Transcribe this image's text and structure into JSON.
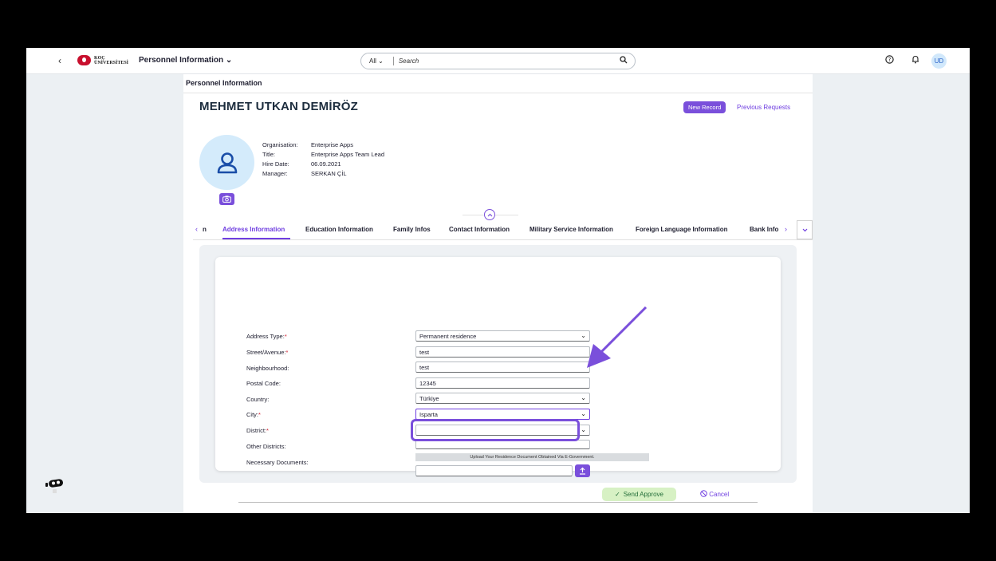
{
  "shell": {
    "back_icon": "‹",
    "logo_text_top": "KOÇ",
    "logo_text_bottom": "ÜNİVERSİTESİ",
    "app_title": "Personnel Information ⌄",
    "search_scope": "All",
    "search_placeholder": "Search",
    "avatar": "UD"
  },
  "page": {
    "breadcrumb": "Personnel Information",
    "employee_name": "MEHMET UTKAN DEMİRÖZ",
    "new_record": "New Record",
    "previous_requests": "Previous Requests",
    "info_labels": [
      "Organisation:",
      "Title:",
      "Hire Date:",
      "Manager:"
    ],
    "info_values": [
      "Enterprise Apps",
      "Enterprise Apps Team Lead",
      "06.09.2021",
      "SERKAN ÇİL"
    ]
  },
  "tabs": {
    "items": [
      {
        "label": "n"
      },
      {
        "label": "Address Information"
      },
      {
        "label": "Education Information"
      },
      {
        "label": "Family Infos"
      },
      {
        "label": "Contact Information"
      },
      {
        "label": "Military Service Information"
      },
      {
        "label": "Foreign Language Information"
      },
      {
        "label": "Bank Info"
      }
    ],
    "active": "Address Information"
  },
  "form": {
    "labels": {
      "address_type": "Address Type:",
      "street": "Street/Avenue:",
      "neighbourhood": "Neighbourhood:",
      "postal_code": "Postal Code:",
      "country": "Country:",
      "city": "City:",
      "district": "District:",
      "other_districts": "Other Districts:",
      "documents": "Necessary Documents:"
    },
    "values": {
      "address_type": "Permanent residence",
      "street": "test",
      "neighbourhood": "test",
      "postal_code": "12345",
      "country": "Türkiye",
      "city": "Isparta",
      "district": "",
      "other_districts": "",
      "document": ""
    },
    "required_mark": "*",
    "upload_hint": "Upload Your Residence Document Obtained Via E-Government.",
    "send_approve": "Send Approve",
    "cancel": "Cancel"
  },
  "colors": {
    "accent": "#6f3ee0",
    "send_bg": "#d7f1c4"
  }
}
